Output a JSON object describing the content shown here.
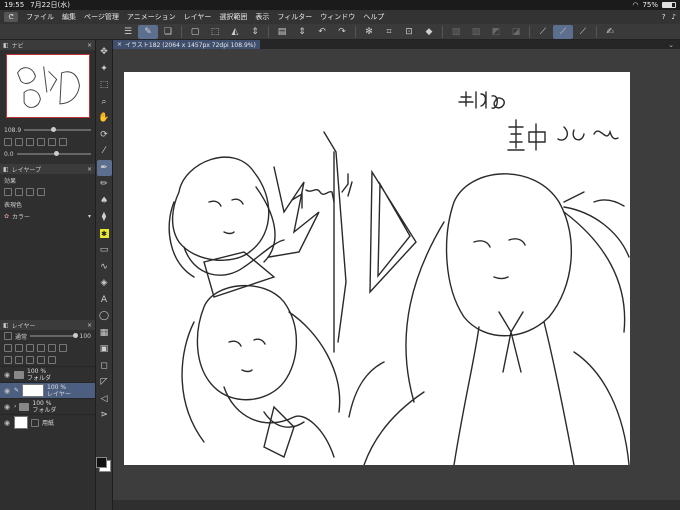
{
  "status": {
    "time": "19:55",
    "date": "7月22日(水)",
    "battery": "75%",
    "battery_level": 0.75
  },
  "menu": {
    "items": [
      "ファイル",
      "編集",
      "ページ管理",
      "アニメーション",
      "レイヤー",
      "選択範囲",
      "表示",
      "フィルター",
      "ウィンドウ",
      "ヘルプ"
    ],
    "right_icons": [
      "help-circle-icon",
      "bell-icon"
    ]
  },
  "tab": {
    "label": "イラスト182 (2064 x 1457px 72dpi 108.9%)",
    "close": "×"
  },
  "navigator": {
    "title": "ナビ",
    "zoom": "108.9",
    "rotation": "0.0"
  },
  "layer_property": {
    "title": "レイヤープ",
    "effect_label": "効果",
    "expression_label": "表現色",
    "expression_value": "カラー"
  },
  "layers": {
    "title": "レイヤー",
    "blend_mode": "通常",
    "opacity": "100",
    "rows": [
      {
        "percent": "100 %",
        "name": "フォルダ"
      },
      {
        "percent": "100 %",
        "name": "レイヤー"
      },
      {
        "percent": "100 %",
        "name": "フォルダ"
      },
      {
        "percent": "",
        "name": "用紙"
      }
    ]
  },
  "colors": {
    "accent": "#5c6f8f",
    "highlight": "#e6e635",
    "selection": "#4d5f80"
  }
}
